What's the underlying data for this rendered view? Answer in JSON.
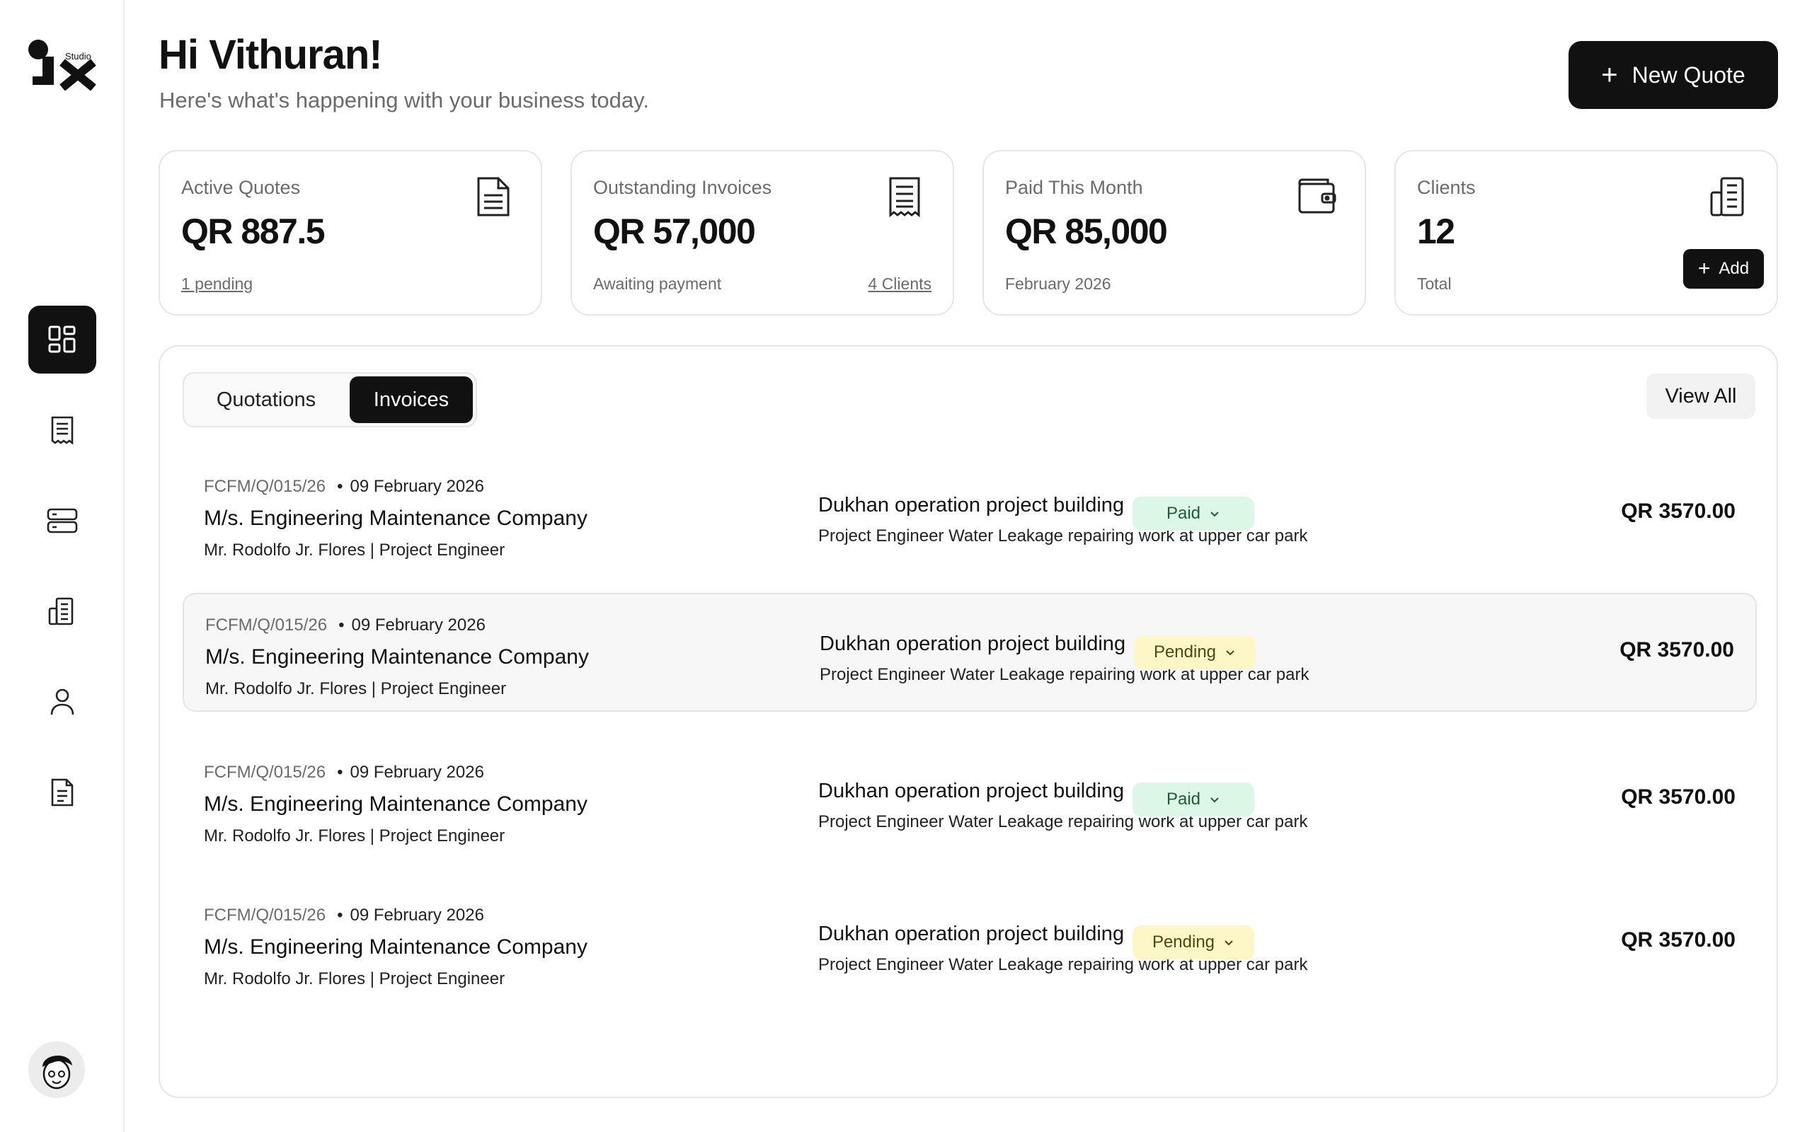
{
  "brand": {
    "logo_small_text": "Studio"
  },
  "sidebar": {
    "items": [
      {
        "name": "dashboard",
        "icon": "dashboard-grid-icon",
        "active": true
      },
      {
        "name": "receipts",
        "icon": "receipt-icon",
        "active": false
      },
      {
        "name": "servers",
        "icon": "server-stack-icon",
        "active": false
      },
      {
        "name": "clients",
        "icon": "building-icon",
        "active": false
      },
      {
        "name": "profile",
        "icon": "user-icon",
        "active": false
      },
      {
        "name": "documents",
        "icon": "document-list-icon",
        "active": false
      }
    ],
    "avatar": "user-avatar"
  },
  "header": {
    "greeting": "Hi Vithuran!",
    "subtitle": "Here's what's happening with your business today.",
    "new_quote_label": "New Quote"
  },
  "stats": [
    {
      "label": "Active Quotes",
      "value": "QR 887.5",
      "foot": "1 pending",
      "icon": "document-icon"
    },
    {
      "label": "Outstanding Invoices",
      "value": "QR 57,000",
      "foot": "Awaiting payment",
      "foot_right": "4 Clients",
      "icon": "receipt-icon"
    },
    {
      "label": "Paid This Month",
      "value": "QR 85,000",
      "foot": "February 2026",
      "icon": "wallet-icon"
    },
    {
      "label": "Clients",
      "value": "12",
      "foot": "Total",
      "icon": "building-icon",
      "add_label": "Add"
    }
  ],
  "panel": {
    "tabs": [
      "Quotations",
      "Invoices"
    ],
    "active_tab": "Invoices",
    "view_all_label": "View All",
    "rows": [
      {
        "ref": "FCFM/Q/015/26",
        "date": "09 February  2026",
        "company": "M/s. Engineering Maintenance Company",
        "person": "Mr. Rodolfo Jr. Flores | Project Engineer",
        "project": "Dukhan operation project building",
        "description": "Project Engineer Water Leakage repairing work at upper car park",
        "status": "Paid",
        "amount": "QR 3570.00"
      },
      {
        "ref": "FCFM/Q/015/26",
        "date": "09 February  2026",
        "company": "M/s. Engineering Maintenance Company",
        "person": "Mr. Rodolfo Jr. Flores | Project Engineer",
        "project": "Dukhan operation project building",
        "description": "Project Engineer Water Leakage repairing work at upper car park",
        "status": "Pending",
        "amount": "QR 3570.00"
      },
      {
        "ref": "FCFM/Q/015/26",
        "date": "09 February  2026",
        "company": "M/s. Engineering Maintenance Company",
        "person": "Mr. Rodolfo Jr. Flores | Project Engineer",
        "project": "Dukhan operation project building",
        "description": "Project Engineer Water Leakage repairing work at upper car park",
        "status": "Paid",
        "amount": "QR 3570.00"
      },
      {
        "ref": "FCFM/Q/015/26",
        "date": "09 February  2026",
        "company": "M/s. Engineering Maintenance Company",
        "person": "Mr. Rodolfo Jr. Flores | Project Engineer",
        "project": "Dukhan operation project building",
        "description": "Project Engineer Water Leakage repairing work at upper car park",
        "status": "Pending",
        "amount": "QR 3570.00"
      }
    ]
  },
  "colors": {
    "primary": "#111111",
    "paid_bg": "#dcf7e6",
    "pending_bg": "#fdf6c6",
    "muted_text": "#6b6b6b",
    "border": "#e6e6e6"
  }
}
